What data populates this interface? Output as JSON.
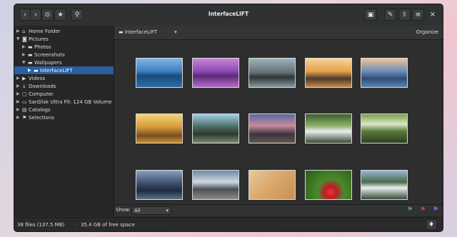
{
  "window": {
    "title": "InterfaceLIFT"
  },
  "header": {
    "back_icon": "‹",
    "forward_icon": "›",
    "history_icon": "⊙",
    "star_icon": "★",
    "search_icon": "⚲",
    "slideshow_icon": "▣",
    "tools_icon": "✎",
    "export_icon": "⇪",
    "menu_icon": "≡",
    "close_icon": "×"
  },
  "sidebar": {
    "items": [
      {
        "label": "Home Folder",
        "icon": "⌂"
      },
      {
        "label": "Pictures",
        "icon": "◙"
      },
      {
        "label": "Photos",
        "icon": "▬"
      },
      {
        "label": "Screenshots",
        "icon": "▬"
      },
      {
        "label": "Wallpapers",
        "icon": "▬"
      },
      {
        "label": "InterfaceLIFT",
        "icon": "▬"
      },
      {
        "label": "Videos",
        "icon": "▶"
      },
      {
        "label": "Downloads",
        "icon": "↓"
      },
      {
        "label": "Computer",
        "icon": "▢"
      },
      {
        "label": "SanDisk Ultra Fit: 124 GB Volume",
        "icon": "▭"
      },
      {
        "label": "Catalogs",
        "icon": "▤"
      },
      {
        "label": "Selections",
        "icon": "⚑"
      }
    ]
  },
  "pathbar": {
    "folder": "InterfaceLIFT",
    "dropdown_icon": "▾",
    "organize": "Organize"
  },
  "bottombar": {
    "show_label": "Show:",
    "filter_value": "All",
    "dropdown_icon": "▾"
  },
  "status": {
    "files": "38 files (137.5 MB)",
    "separator": "·",
    "free": "35.4 GB of free space",
    "bulb_icon": "♦"
  },
  "flags": {
    "green": "#3fae3f",
    "red": "#c0453c",
    "purple": "#9a5ad0"
  }
}
